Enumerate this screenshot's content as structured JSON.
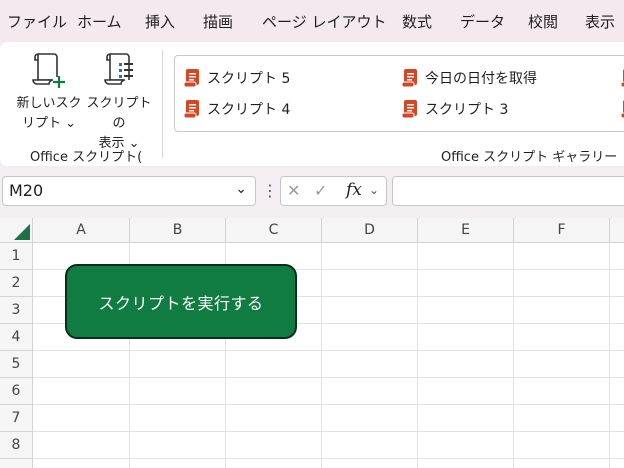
{
  "menu": [
    "ファイル",
    "ホーム",
    "挿入",
    "描画",
    "ページ レイアウト",
    "数式",
    "データ",
    "校閲",
    "表示"
  ],
  "ribbon": {
    "new_script_label_1": "新しいスク",
    "new_script_label_2": "リプト ⌄",
    "show_script_label_1": "スクリプトの",
    "show_script_label_2": "表示 ⌄",
    "group_office_scripts": "Office スクリプト(",
    "group_gallery": "Office スクリプト ギャラリー",
    "gallery_items": [
      "スクリプト 5",
      "スクリプト 4",
      "今日の日付を取得",
      "スクリプト 3"
    ]
  },
  "formula_bar": {
    "name_box_value": "M20",
    "name_box_chevron": "⌄",
    "options_glyph": "⋮",
    "cancel_glyph": "✕",
    "enter_glyph": "✓",
    "fx_label": "fx",
    "fx_chevron": "⌄",
    "formula_value": ""
  },
  "sheet": {
    "columns": [
      "A",
      "B",
      "C",
      "D",
      "E",
      "F"
    ],
    "rows": [
      "1",
      "2",
      "3",
      "4",
      "5",
      "6",
      "7",
      "8"
    ]
  },
  "run_button_label": "スクリプトを実行する",
  "colors": {
    "accent_green": "#107c41",
    "script_icon_orange": "#d24726",
    "menubar_bg": "#f3e9ef"
  }
}
